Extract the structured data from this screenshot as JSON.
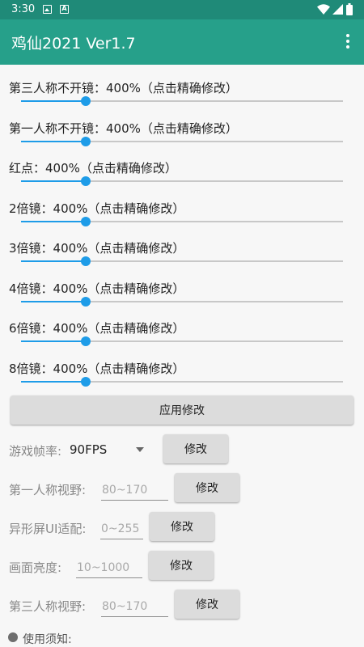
{
  "status_bar": {
    "time": "3:30",
    "notification_icons": [
      "image-icon",
      "a-icon"
    ],
    "system_icons": [
      "wifi-icon",
      "signal-icon",
      "battery-icon"
    ]
  },
  "app_bar": {
    "title": "鸡仙2021 Ver1.7",
    "menu_icon": "more-vert-icon"
  },
  "accent_color": "#1e9ce8",
  "app_bar_color": "#26a08a",
  "sliders": [
    {
      "label": "第三人称不开镜：400%（点击精确修改）",
      "value_fraction": 0.2
    },
    {
      "label": "第一人称不开镜：400%（点击精确修改）",
      "value_fraction": 0.2
    },
    {
      "label": "红点：400%（点击精确修改）",
      "value_fraction": 0.2
    },
    {
      "label": "2倍镜：400%（点击精确修改）",
      "value_fraction": 0.2
    },
    {
      "label": "3倍镜：400%（点击精确修改）",
      "value_fraction": 0.2
    },
    {
      "label": "4倍镜：400%（点击精确修改）",
      "value_fraction": 0.2
    },
    {
      "label": "6倍镜：400%（点击精确修改）",
      "value_fraction": 0.2
    },
    {
      "label": "8倍镜：400%（点击精确修改）",
      "value_fraction": 0.2
    }
  ],
  "apply_button": "应用修改",
  "fields": {
    "fps": {
      "label": "游戏帧率:",
      "selected": "90FPS",
      "button": "修改"
    },
    "fov_first": {
      "label": "第一人称视野:",
      "placeholder": "80~170",
      "button": "修改"
    },
    "notch": {
      "label": "异形屏UI适配:",
      "placeholder": "0~255",
      "button": "修改"
    },
    "brightness": {
      "label": "画面亮度:",
      "placeholder": "10~1000",
      "button": "修改"
    },
    "fov_third": {
      "label": "第三人称视野:",
      "placeholder": "80~170",
      "button": "修改"
    }
  },
  "notice": "使用须知:"
}
